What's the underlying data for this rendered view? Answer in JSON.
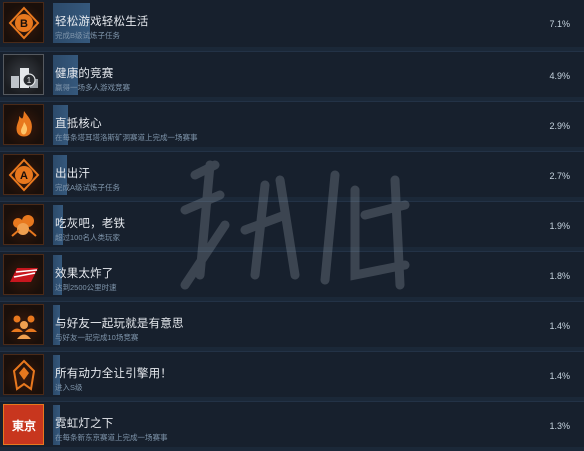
{
  "achievements": [
    {
      "title": "轻松游戏轻松生活",
      "desc": "完成B级试炼子任务",
      "percent": "7.1%",
      "value": 0.071,
      "icon": "b-grade-badge-icon"
    },
    {
      "title": "健康的竞赛",
      "desc": "赢得一场多人游戏竞赛",
      "percent": "4.9%",
      "value": 0.049,
      "icon": "podium-first-icon"
    },
    {
      "title": "直抵核心",
      "desc": "在每条塔耳塔洛斯矿洞赛道上完成一场赛事",
      "percent": "2.9%",
      "value": 0.029,
      "icon": "core-flame-icon"
    },
    {
      "title": "出出汗",
      "desc": "完成A级试炼子任务",
      "percent": "2.7%",
      "value": 0.027,
      "icon": "a-grade-badge-icon"
    },
    {
      "title": "吃灰吧，老铁",
      "desc": "超过100名人类玩家",
      "percent": "1.9%",
      "value": 0.019,
      "icon": "dust-cloud-icon"
    },
    {
      "title": "效果太炸了",
      "desc": "达到2500公里时速",
      "percent": "1.8%",
      "value": 0.018,
      "icon": "speed-logo-icon"
    },
    {
      "title": "与好友一起玩就是有意思",
      "desc": "与好友一起完成10场竞赛",
      "percent": "1.4%",
      "value": 0.014,
      "icon": "friends-group-icon"
    },
    {
      "title": "所有动力全让引擎用！",
      "desc": "进入S级",
      "percent": "1.4%",
      "value": 0.014,
      "icon": "s-grade-ship-icon"
    },
    {
      "title": "霓虹灯之下",
      "desc": "在每条新东京赛道上完成一场赛事",
      "percent": "1.3%",
      "value": 0.013,
      "icon": "tokyo-sign-icon"
    }
  ],
  "icon_text": [
    "B",
    "1",
    "A",
    "东京"
  ],
  "watermark": "游侠网",
  "colors": {
    "background": "#1b2838",
    "row": "#17202d",
    "progress": "#35587c",
    "icon_accent": "#e8781e"
  }
}
